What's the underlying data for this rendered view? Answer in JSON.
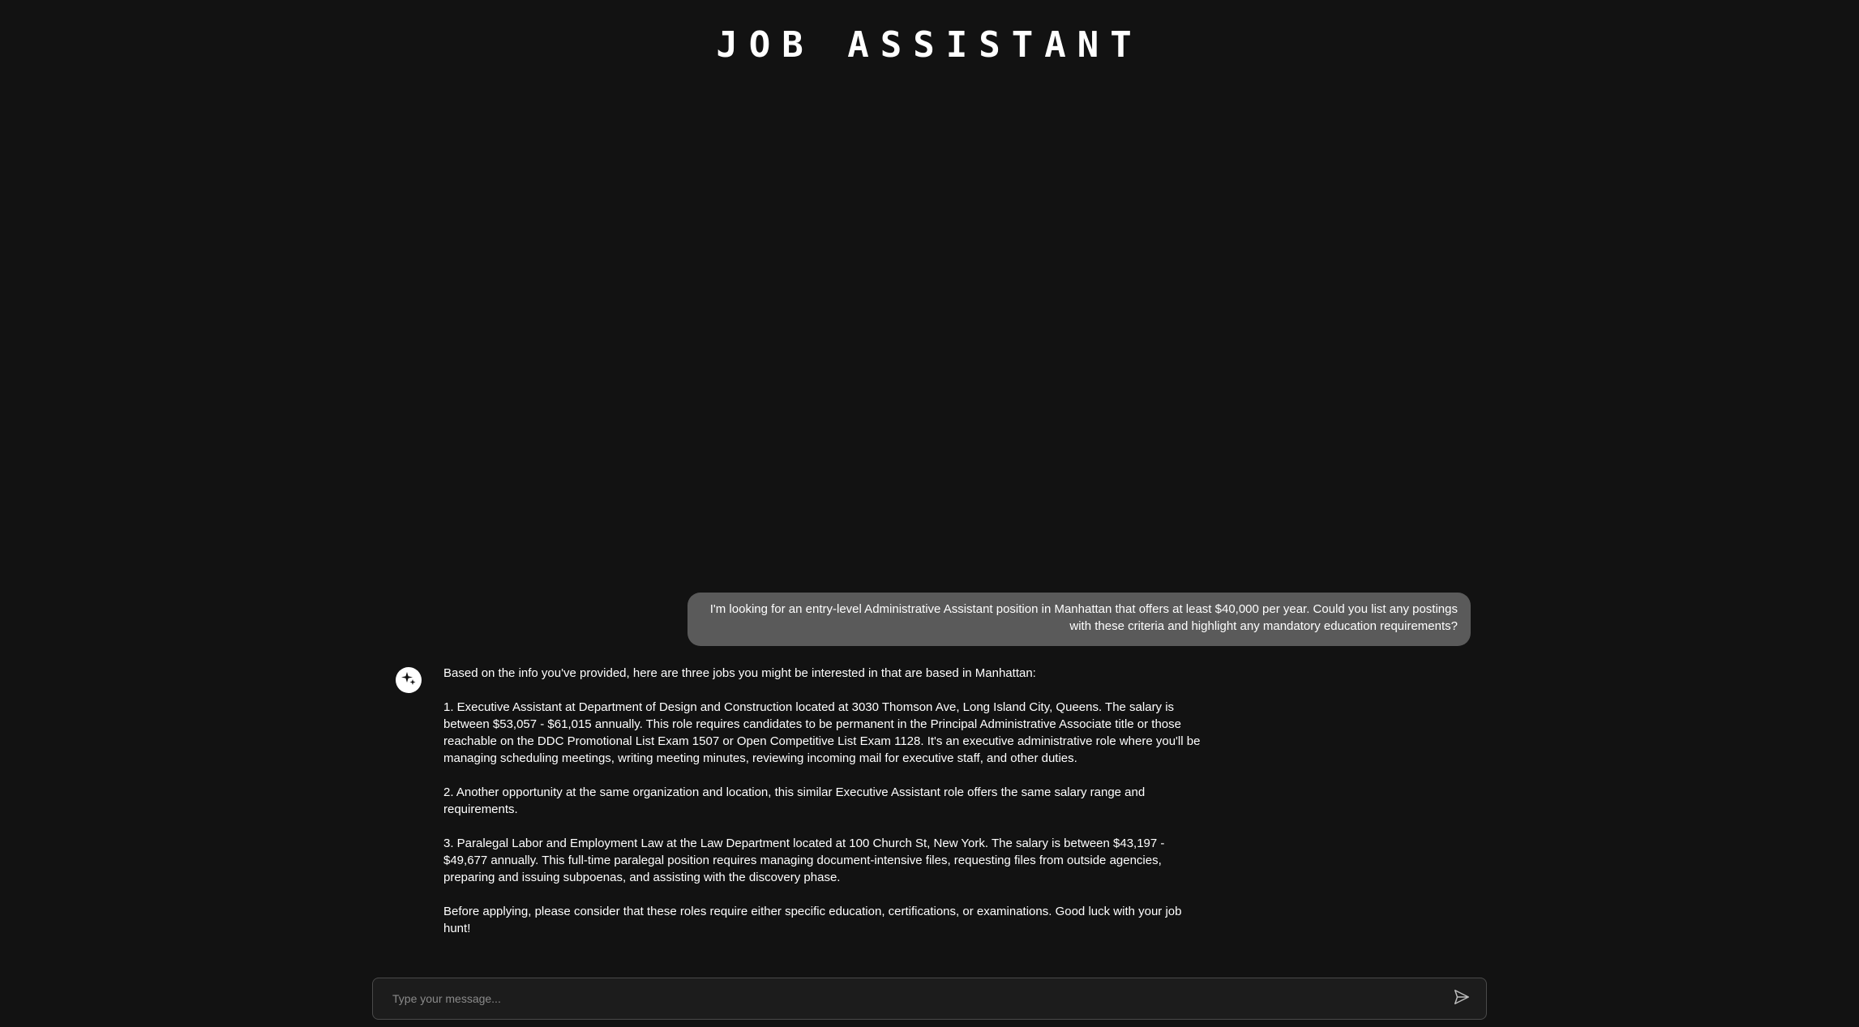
{
  "app": {
    "title": "JOB ASSISTANT"
  },
  "conversation": {
    "user_message": "I'm looking for an entry-level Administrative Assistant position in Manhattan that offers at least $40,000 per year. Could you list any postings with these criteria and highlight any mandatory education requirements?",
    "assistant_message": {
      "avatar_icon": "sparkle-icon",
      "paragraphs": [
        "Based on the info you've provided, here are three jobs you might be interested in that are based in Manhattan:",
        "1. Executive Assistant at Department of Design and Construction located at 3030 Thomson Ave, Long Island City, Queens. The salary is between $53,057 - $61,015 annually. This role requires candidates to be permanent in the Principal Administrative Associate title or those reachable on the DDC Promotional List Exam 1507 or Open Competitive List Exam 1128. It's an executive administrative role where you'll be managing scheduling meetings, writing meeting minutes, reviewing incoming mail for executive staff, and other duties.",
        "2. Another opportunity at the same organization and location, this similar Executive Assistant role offers the same salary range and requirements.",
        "3. Paralegal Labor and Employment Law at the Law Department located at 100 Church St, New York. The salary is between $43,197 - $49,677 annually. This full-time paralegal position requires managing document-intensive files, requesting files from outside agencies, preparing and issuing subpoenas, and assisting with the discovery phase.",
        "Before applying, please consider that these roles require either specific education, certifications, or examinations. Good luck with your job hunt!"
      ]
    }
  },
  "composer": {
    "placeholder": "Type your message...",
    "value": "",
    "send_icon": "send-icon"
  },
  "colors": {
    "background": "#121212",
    "user_bubble": "#5a5a5a",
    "composer_bg": "#1c1c1c",
    "composer_border": "#4a4a4a",
    "text": "#ffffff"
  }
}
